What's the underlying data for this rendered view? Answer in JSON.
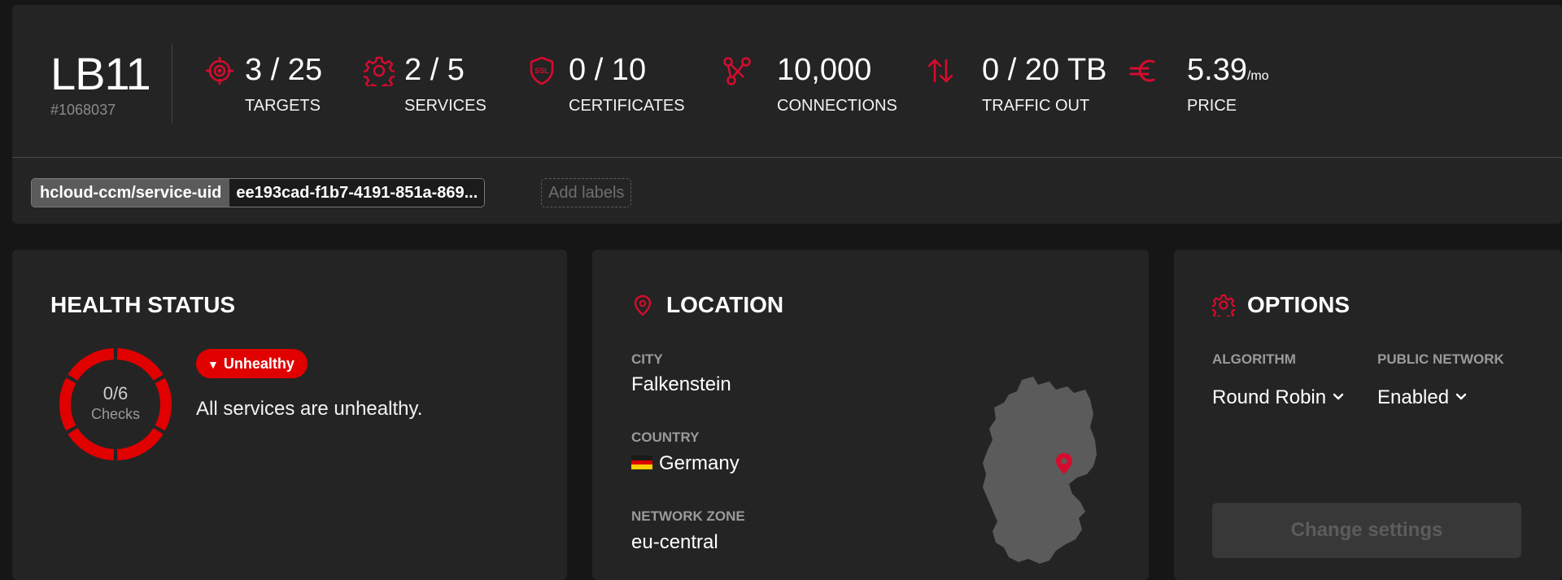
{
  "load_balancer": {
    "name": "LB11",
    "id": "#1068037"
  },
  "stats": [
    {
      "icon": "target-icon",
      "value": "3 / 25",
      "unit": "",
      "label": "TARGETS"
    },
    {
      "icon": "gear-icon",
      "value": "2 / 5",
      "unit": "",
      "label": "SERVICES"
    },
    {
      "icon": "ssl-shield-icon",
      "value": "0 / 10",
      "unit": "",
      "label": "CERTIFICATES"
    },
    {
      "icon": "connections-icon",
      "value": "10,000",
      "unit": "",
      "label": "CONNECTIONS"
    },
    {
      "icon": "traffic-arrows-icon",
      "value": "0 / 20 TB",
      "unit": "",
      "label": "TRAFFIC OUT"
    },
    {
      "icon": "euro-icon",
      "value": "5.39",
      "unit": "/mo",
      "label": "PRICE"
    }
  ],
  "labels": {
    "items": [
      {
        "key": "hcloud-ccm/service-uid",
        "value": "ee193cad-f1b7-4191-851a-869..."
      }
    ],
    "add_placeholder": "Add labels"
  },
  "health": {
    "title": "HEALTH STATUS",
    "checks_value": "0/6",
    "checks_label": "Checks",
    "badge": "Unhealthy",
    "message": "All services are unhealthy.",
    "ring_color": "#e00000"
  },
  "location": {
    "title": "LOCATION",
    "city_label": "CITY",
    "city": "Falkenstein",
    "country_label": "COUNTRY",
    "country": "Germany",
    "zone_label": "NETWORK ZONE",
    "zone": "eu-central"
  },
  "options": {
    "title": "OPTIONS",
    "algorithm_label": "ALGORITHM",
    "algorithm": "Round Robin",
    "network_label": "PUBLIC NETWORK",
    "network": "Enabled",
    "change_button": "Change settings"
  },
  "colors": {
    "accent": "#d50c2d",
    "card": "#242424",
    "background": "#161616"
  }
}
